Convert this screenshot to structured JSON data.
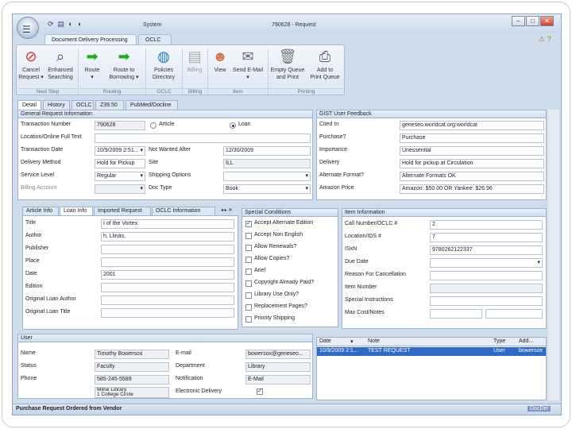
{
  "window": {
    "system_label": "System",
    "title": "790628 - Request",
    "controls": [
      "–",
      "□",
      "✕"
    ]
  },
  "ribbon": {
    "tabs": [
      "Document Delivery Processing",
      "OCLC"
    ],
    "buttons": [
      {
        "l1": "Cancel",
        "l2": "Request ▾",
        "icon": "cancel-icon"
      },
      {
        "l1": "Enhanced",
        "l2": "Searching",
        "icon": "search-icon"
      },
      {
        "l1": "Route",
        "l2": "▾",
        "icon": "arrow-right-icon"
      },
      {
        "l1": "Route to",
        "l2": "Borrowing ▾",
        "icon": "arrow-right-icon"
      },
      {
        "l1": "Policies",
        "l2": "Directory",
        "icon": "globe-icon"
      },
      {
        "l1": "Billing",
        "l2": "",
        "icon": "billing-icon"
      },
      {
        "l1": "View",
        "l2": "",
        "icon": "person-icon"
      },
      {
        "l1": "Send E-Mail",
        "l2": "▾",
        "icon": "email-icon"
      },
      {
        "l1": "Empty Queue",
        "l2": "and Print",
        "icon": "trash-icon"
      },
      {
        "l1": "Add to",
        "l2": "Print Queue",
        "icon": "printer-icon"
      }
    ],
    "groups": [
      "Next Step",
      "Routing",
      "OCLC",
      "Billing",
      "Item",
      "Printing"
    ]
  },
  "detail_tabs": [
    "Detail",
    "History",
    "OCLC",
    "Z39.50",
    "PubMed/Docline"
  ],
  "general": {
    "header": "General Request Information",
    "transaction_number_label": "Transaction Number",
    "transaction_number": "790628",
    "radio_article": "Article",
    "radio_loan": "Loan",
    "location_label": "Location/Online Full Text",
    "transaction_date_label": "Transaction Date",
    "transaction_date": "10/9/2009 2:51...",
    "not_wanted_label": "Not Wanted After",
    "not_wanted": "12/30/2009",
    "delivery_method_label": "Delivery Method",
    "delivery_method": "Hold for Pickup",
    "site_label": "Site",
    "site": "ILL",
    "service_level_label": "Service Level",
    "service_level": "Regular",
    "shipping_label": "Shipping Options",
    "billing_account_label": "Billing Account",
    "doc_type_label": "Doc Type",
    "doc_type": "Book"
  },
  "gist": {
    "header": "GIST User Feedback",
    "rows": [
      {
        "label": "Cited In",
        "value": "geneseo.worldcat.org:worldcat"
      },
      {
        "label": "Purchase?",
        "value": "Purchase"
      },
      {
        "label": "Importance",
        "value": "Unessential"
      },
      {
        "label": "Delivery",
        "value": "Hold for pickup at Circulation"
      },
      {
        "label": "Alternate Format?",
        "value": "Alternate Formats OK"
      },
      {
        "label": "Amazon Price",
        "value": "Amazon: $50.00 OR Yankee: $26.96"
      }
    ]
  },
  "loan_tabs": [
    "Article Info",
    "Loan Info",
    "Imported Request",
    "OCLC Information"
  ],
  "loan": {
    "rows": [
      {
        "label": "Title",
        "value": "I of the Vortex"
      },
      {
        "label": "Author",
        "value": "h, Llinás,"
      },
      {
        "label": "Publisher",
        "value": ""
      },
      {
        "label": "Place",
        "value": ""
      },
      {
        "label": "Date",
        "value": "2001"
      },
      {
        "label": "Edition",
        "value": ""
      },
      {
        "label": "Original Loan Author",
        "value": ""
      },
      {
        "label": "Original Loan Title",
        "value": ""
      }
    ]
  },
  "special": {
    "header": "Special Conditions",
    "items": [
      {
        "label": "Accept Alternate Edition",
        "checked": true
      },
      {
        "label": "Accept Non English",
        "checked": false
      },
      {
        "label": "Allow Renewals?",
        "checked": false
      },
      {
        "label": "Allow Copies?",
        "checked": false
      },
      {
        "label": "Ariel",
        "checked": false
      },
      {
        "label": "Copyright Already Paid?",
        "checked": false
      },
      {
        "label": "Library Use Only?",
        "checked": false
      },
      {
        "label": "Replacement Pages?",
        "checked": false
      },
      {
        "label": "Priority Shipping",
        "checked": false
      }
    ]
  },
  "item": {
    "header": "Item Information",
    "rows": [
      {
        "label": "Call Number/OCLC #",
        "value": "2"
      },
      {
        "label": "Location/IDS #",
        "value": "7"
      },
      {
        "label": "ISxN",
        "value": "9780262122337"
      },
      {
        "label": "Due Date",
        "value": ""
      },
      {
        "label": "Reason For Cancellation",
        "value": ""
      },
      {
        "label": "Item Number",
        "value": ""
      },
      {
        "label": "Special Instructions",
        "value": ""
      },
      {
        "label": "Max Cost/Notes",
        "value": ""
      }
    ]
  },
  "user": {
    "header": "User",
    "name_label": "Name",
    "name": "Timothy Bowersox",
    "email_label": "E-mail",
    "email": "bowersox@geneseo...",
    "status_label": "Status",
    "status": "Faculty",
    "department_label": "Department",
    "department": "Library",
    "phone_label": "Phone",
    "phone": "585-245-5589",
    "notification_label": "Notification",
    "notification": "E-Mail",
    "address1": "Milne Library",
    "address2": "1 College Circle",
    "electronic_delivery_label": "Electronic Delivery",
    "electronic_delivery": true
  },
  "notes": {
    "columns": [
      "Date",
      "Note",
      "Type",
      "Add..."
    ],
    "rows": [
      {
        "date": "10/9/2009 2:1...",
        "note": "TEST REQUEST",
        "type": "User",
        "by": "bowersox"
      }
    ],
    "selected_color": "#316ac5"
  },
  "status_bar": {
    "message": "Purchase Request Ordered from Vendor",
    "right": "DocDel"
  }
}
